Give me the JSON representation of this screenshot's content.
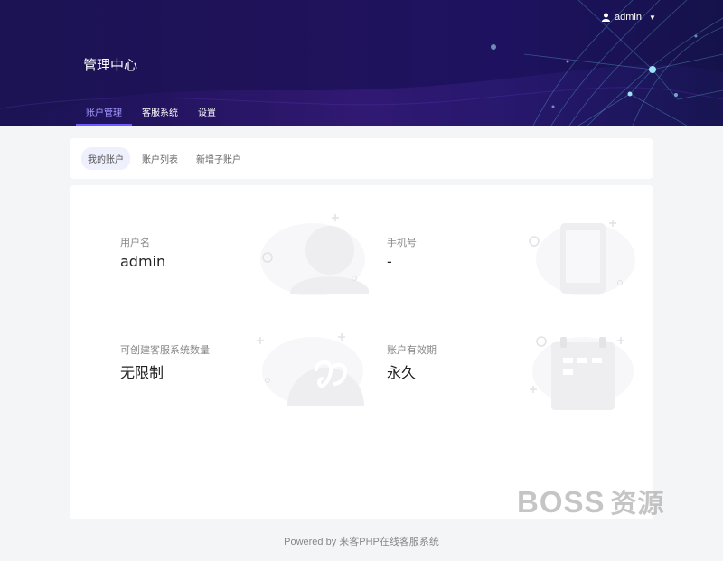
{
  "header": {
    "app_title": "管理中心",
    "user_name": "admin",
    "user_icon": "user-icon",
    "caret_icon": "caret-down-icon"
  },
  "nav": {
    "tabs": [
      {
        "label": "账户管理",
        "active": true
      },
      {
        "label": "客服系统",
        "active": false
      },
      {
        "label": "设置",
        "active": false
      }
    ]
  },
  "subnav": {
    "tabs": [
      {
        "label": "我的账户",
        "active": true
      },
      {
        "label": "账户列表",
        "active": false
      },
      {
        "label": "新增子账户",
        "active": false
      }
    ]
  },
  "account": {
    "username_label": "用户名",
    "username_value": "admin",
    "phone_label": "手机号",
    "phone_value": "-",
    "quota_label": "可创建客服系统数量",
    "quota_value": "无限制",
    "expiry_label": "账户有效期",
    "expiry_value": "永久"
  },
  "footer": {
    "text": "Powered by 来客PHP在线客服系统"
  },
  "watermark": {
    "latin": "BOSS",
    "cn": "资源"
  },
  "colors": {
    "header_bg": "#1b1354",
    "accent": "#6b5cff",
    "page_bg": "#f4f5f7"
  }
}
